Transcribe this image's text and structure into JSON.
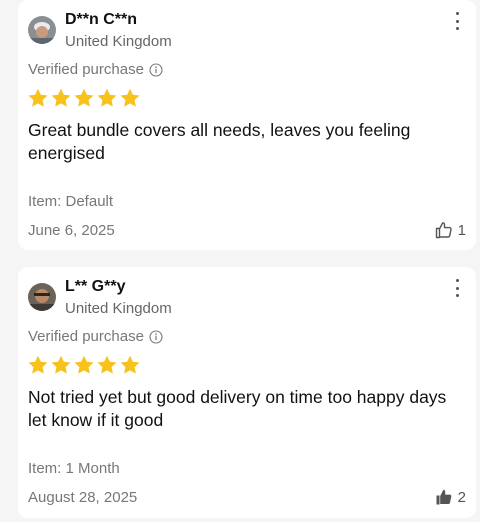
{
  "reviews": [
    {
      "name": "D**n C**n",
      "country": "United Kingdom",
      "verified_label": "Verified purchase",
      "rating": 5,
      "text": "Great bundle covers all needs, leaves you feeling energised",
      "item": "Item: Default",
      "date": "June 6, 2025",
      "helpful_count": "1",
      "helpful_active": false
    },
    {
      "name": "L** G**y",
      "country": "United Kingdom",
      "verified_label": "Verified purchase",
      "rating": 5,
      "text": "Not tried yet but good delivery on time too happy days let know if it good",
      "item": "Item: 1 Month",
      "date": "August 28, 2025",
      "helpful_count": "2",
      "helpful_active": true
    }
  ],
  "colors": {
    "star": "#f7c21b",
    "muted_text": "#777777",
    "card_bg": "#ffffff",
    "page_bg": "#f5f5f5"
  },
  "icons": {
    "info": "info-circle-icon",
    "more": "more-vertical-icon",
    "helpful": "thumbs-up-icon",
    "star": "star-icon"
  }
}
